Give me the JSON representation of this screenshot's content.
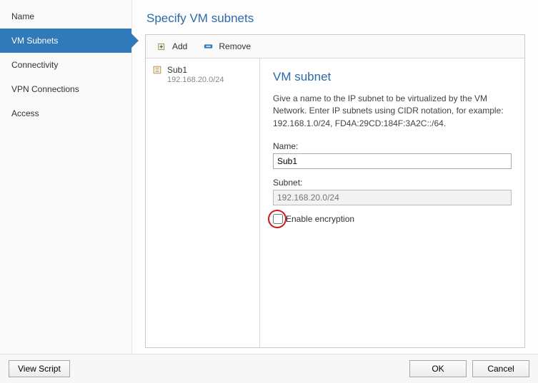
{
  "sidebar": {
    "items": [
      {
        "label": "Name",
        "active": false
      },
      {
        "label": "VM Subnets",
        "active": true
      },
      {
        "label": "Connectivity",
        "active": false
      },
      {
        "label": "VPN Connections",
        "active": false
      },
      {
        "label": "Access",
        "active": false
      }
    ]
  },
  "page": {
    "title": "Specify VM subnets"
  },
  "toolbar": {
    "add_label": "Add",
    "remove_label": "Remove"
  },
  "subnets": {
    "items": [
      {
        "name": "Sub1",
        "cidr": "192.168.20.0/24"
      }
    ]
  },
  "detail": {
    "title": "VM subnet",
    "description": "Give a name to the IP subnet to be virtualized by the VM Network. Enter IP subnets using CIDR notation, for example: 192.168.1.0/24, FD4A:29CD:184F:3A2C::/64.",
    "name_label": "Name:",
    "name_value": "Sub1",
    "subnet_label": "Subnet:",
    "subnet_value": "192.168.20.0/24",
    "encryption_label": "Enable encryption",
    "encryption_checked": false
  },
  "footer": {
    "view_script": "View Script",
    "ok": "OK",
    "cancel": "Cancel"
  }
}
